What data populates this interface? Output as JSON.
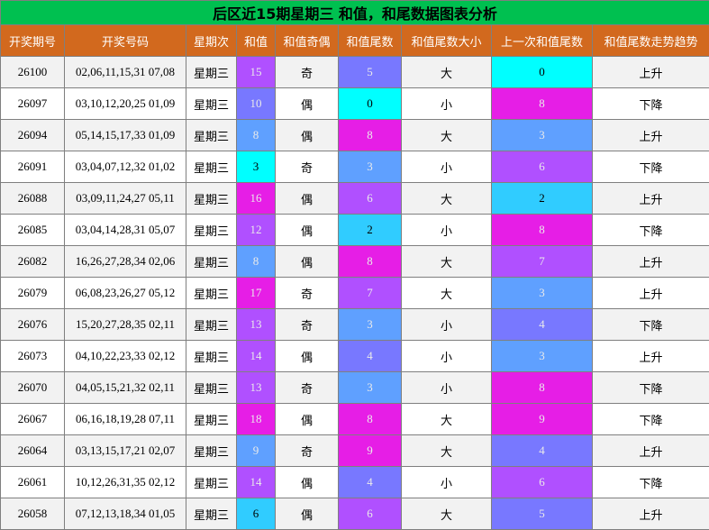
{
  "title": "后区近15期星期三 和值，和尾数据图表分析",
  "columns": [
    "开奖期号",
    "开奖号码",
    "星期次",
    "和值",
    "和值奇偶",
    "和值尾数",
    "和值尾数大小",
    "上一次和值尾数",
    "和值尾数走势趋势"
  ],
  "colors": {
    "title_bg": "#00c050",
    "header_bg": "#d2691e",
    "row_even_bg": "#f2f2f2",
    "row_odd_bg": "#ffffff",
    "palette": {
      "magenta": "#e61ee6",
      "blue": "#5fa0ff",
      "cyan": "#00ffff",
      "purple": "#b050ff",
      "skyblue": "#30ccff",
      "indigo": "#7878ff"
    }
  },
  "rows": [
    {
      "issue": "26100",
      "numbers": "02,06,11,15,31 07,08",
      "weekday": "星期三",
      "sum": "15",
      "sum_color": "purple",
      "parity": "奇",
      "tail": "5",
      "tail_color": "indigo",
      "size": "大",
      "prev_tail": "0",
      "prev_color": "cyan",
      "trend": "上升"
    },
    {
      "issue": "26097",
      "numbers": "03,10,12,20,25 01,09",
      "weekday": "星期三",
      "sum": "10",
      "sum_color": "indigo",
      "parity": "偶",
      "tail": "0",
      "tail_color": "cyan",
      "size": "小",
      "prev_tail": "8",
      "prev_color": "magenta",
      "trend": "下降"
    },
    {
      "issue": "26094",
      "numbers": "05,14,15,17,33 01,09",
      "weekday": "星期三",
      "sum": "8",
      "sum_color": "blue",
      "parity": "偶",
      "tail": "8",
      "tail_color": "magenta",
      "size": "大",
      "prev_tail": "3",
      "prev_color": "blue",
      "trend": "上升"
    },
    {
      "issue": "26091",
      "numbers": "03,04,07,12,32 01,02",
      "weekday": "星期三",
      "sum": "3",
      "sum_color": "cyan",
      "parity": "奇",
      "tail": "3",
      "tail_color": "blue",
      "size": "小",
      "prev_tail": "6",
      "prev_color": "purple",
      "trend": "下降"
    },
    {
      "issue": "26088",
      "numbers": "03,09,11,24,27 05,11",
      "weekday": "星期三",
      "sum": "16",
      "sum_color": "magenta",
      "parity": "偶",
      "tail": "6",
      "tail_color": "purple",
      "size": "大",
      "prev_tail": "2",
      "prev_color": "skyblue",
      "trend": "上升"
    },
    {
      "issue": "26085",
      "numbers": "03,04,14,28,31 05,07",
      "weekday": "星期三",
      "sum": "12",
      "sum_color": "purple",
      "parity": "偶",
      "tail": "2",
      "tail_color": "skyblue",
      "size": "小",
      "prev_tail": "8",
      "prev_color": "magenta",
      "trend": "下降"
    },
    {
      "issue": "26082",
      "numbers": "16,26,27,28,34 02,06",
      "weekday": "星期三",
      "sum": "8",
      "sum_color": "blue",
      "parity": "偶",
      "tail": "8",
      "tail_color": "magenta",
      "size": "大",
      "prev_tail": "7",
      "prev_color": "purple",
      "trend": "上升"
    },
    {
      "issue": "26079",
      "numbers": "06,08,23,26,27 05,12",
      "weekday": "星期三",
      "sum": "17",
      "sum_color": "magenta",
      "parity": "奇",
      "tail": "7",
      "tail_color": "purple",
      "size": "大",
      "prev_tail": "3",
      "prev_color": "blue",
      "trend": "上升"
    },
    {
      "issue": "26076",
      "numbers": "15,20,27,28,35 02,11",
      "weekday": "星期三",
      "sum": "13",
      "sum_color": "purple",
      "parity": "奇",
      "tail": "3",
      "tail_color": "blue",
      "size": "小",
      "prev_tail": "4",
      "prev_color": "indigo",
      "trend": "下降"
    },
    {
      "issue": "26073",
      "numbers": "04,10,22,23,33 02,12",
      "weekday": "星期三",
      "sum": "14",
      "sum_color": "purple",
      "parity": "偶",
      "tail": "4",
      "tail_color": "indigo",
      "size": "小",
      "prev_tail": "3",
      "prev_color": "blue",
      "trend": "上升"
    },
    {
      "issue": "26070",
      "numbers": "04,05,15,21,32 02,11",
      "weekday": "星期三",
      "sum": "13",
      "sum_color": "purple",
      "parity": "奇",
      "tail": "3",
      "tail_color": "blue",
      "size": "小",
      "prev_tail": "8",
      "prev_color": "magenta",
      "trend": "下降"
    },
    {
      "issue": "26067",
      "numbers": "06,16,18,19,28 07,11",
      "weekday": "星期三",
      "sum": "18",
      "sum_color": "magenta",
      "parity": "偶",
      "tail": "8",
      "tail_color": "magenta",
      "size": "大",
      "prev_tail": "9",
      "prev_color": "magenta",
      "trend": "下降"
    },
    {
      "issue": "26064",
      "numbers": "03,13,15,17,21 02,07",
      "weekday": "星期三",
      "sum": "9",
      "sum_color": "blue",
      "parity": "奇",
      "tail": "9",
      "tail_color": "magenta",
      "size": "大",
      "prev_tail": "4",
      "prev_color": "indigo",
      "trend": "上升"
    },
    {
      "issue": "26061",
      "numbers": "10,12,26,31,35 02,12",
      "weekday": "星期三",
      "sum": "14",
      "sum_color": "purple",
      "parity": "偶",
      "tail": "4",
      "tail_color": "indigo",
      "size": "小",
      "prev_tail": "6",
      "prev_color": "purple",
      "trend": "下降"
    },
    {
      "issue": "26058",
      "numbers": "07,12,13,18,34 01,05",
      "weekday": "星期三",
      "sum": "6",
      "sum_color": "skyblue",
      "parity": "偶",
      "tail": "6",
      "tail_color": "purple",
      "size": "大",
      "prev_tail": "5",
      "prev_color": "indigo",
      "trend": "上升"
    }
  ]
}
